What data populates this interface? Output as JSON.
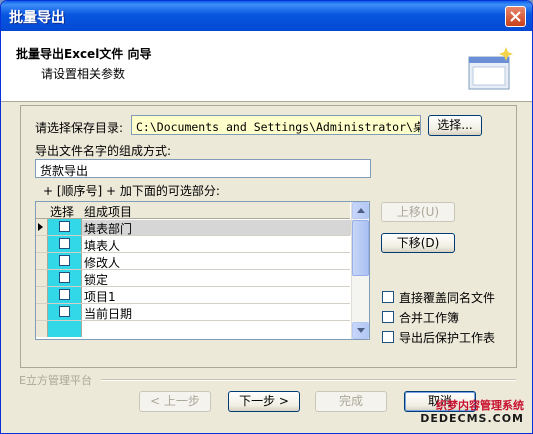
{
  "window": {
    "title": "批量导出"
  },
  "header": {
    "title": "批量导出Excel文件 向导",
    "subtitle": "请设置相关参数"
  },
  "form": {
    "save_dir_label": "请选择保存目录:",
    "save_dir_value": "C:\\Documents and Settings\\Administrator\\桌面",
    "choose_button": "选择...",
    "filename_label": "导出文件名字的组成方式:",
    "filename_value": "货款导出",
    "optional_parts_label": "+ [顺序号] + 加下面的可选部分:"
  },
  "grid": {
    "columns": [
      "选择",
      "组成项目"
    ],
    "rows": [
      {
        "name": "填表部门",
        "checked": false,
        "current": true
      },
      {
        "name": "填表人",
        "checked": false
      },
      {
        "name": "修改人",
        "checked": false
      },
      {
        "name": "锁定",
        "checked": false
      },
      {
        "name": "项目1",
        "checked": false
      },
      {
        "name": "当前日期",
        "checked": false
      }
    ]
  },
  "side": {
    "move_up": "上移(U)",
    "move_down": "下移(D)"
  },
  "options": {
    "overwrite": "直接覆盖同名文件",
    "merge": "合并工作簿",
    "protect": "导出后保护工作表"
  },
  "footer": {
    "platform_label": "E立方管理平台",
    "prev": "< 上一步",
    "next": "下一步 >",
    "finish": "完成",
    "cancel": "取消"
  },
  "watermark": {
    "line1": "织梦内容管理系统",
    "line2": "DEDECMS.COM"
  },
  "colors": {
    "titlebar": "#0856e0",
    "select_column": "#33d8e8",
    "path_field": "#ffffcc"
  }
}
